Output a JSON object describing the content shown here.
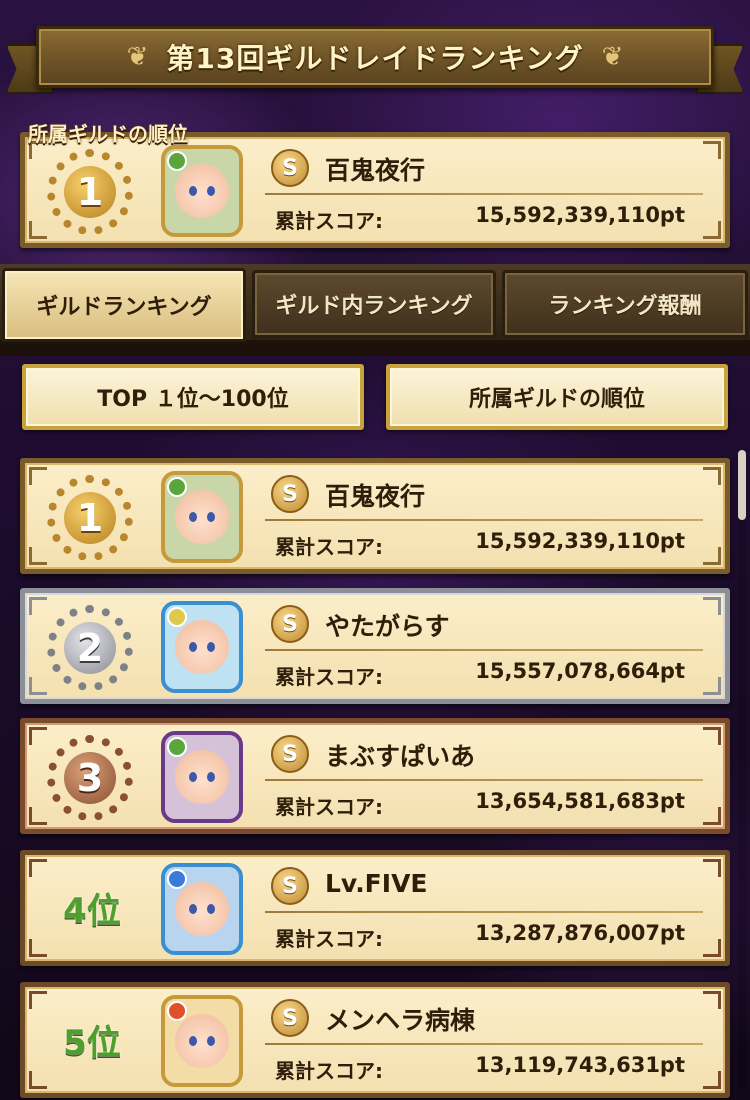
{
  "title": "第13回ギルドレイドランキング",
  "my_guild": {
    "section_label": "所属ギルドの順位",
    "rank": "1",
    "medal": "gold",
    "avatar_icon": "girl-green-bow-avatar",
    "element_color": "#5aa63c",
    "frame_color": "#c59a3a",
    "name": "百鬼夜行",
    "score_label": "累計スコア:",
    "score": "15,592,339,110pt"
  },
  "tabs": [
    {
      "label": "ギルドランキング",
      "active": true
    },
    {
      "label": "ギルド内ランキング",
      "active": false
    },
    {
      "label": "ランキング報酬",
      "active": false
    }
  ],
  "filters": {
    "top_label": "TOP １位〜100位",
    "mine_label": "所属ギルドの順位"
  },
  "ranking": [
    {
      "rank": "1",
      "medal": "gold",
      "name": "百鬼夜行",
      "score_label": "累計スコア:",
      "score": "15,592,339,110pt",
      "avatar_icon": "girl-green-bow-avatar",
      "element_color": "#5aa63c",
      "frame_color": "#c59a3a",
      "avatar_bg": "#c8d6a8"
    },
    {
      "rank": "2",
      "medal": "silver",
      "name": "やたがらす",
      "score_label": "累計スコア:",
      "score": "15,557,078,664pt",
      "avatar_icon": "white-creature-avatar",
      "element_color": "#e0c84a",
      "frame_color": "#3a8fd2",
      "avatar_bg": "#bfe2f2"
    },
    {
      "rank": "3",
      "medal": "bronze",
      "name": "まぶすぱいあ",
      "score_label": "累計スコア:",
      "score": "13,654,581,683pt",
      "avatar_icon": "vampire-girl-avatar",
      "element_color": "#5aa63c",
      "frame_color": "#6a3a8a",
      "avatar_bg": "#d6c2d8"
    },
    {
      "rank": "4位",
      "medal": "none",
      "name": "Lv.FIVE",
      "score_label": "累計スコア:",
      "score": "13,287,876,007pt",
      "avatar_icon": "blue-hair-girl-avatar",
      "element_color": "#3a7ad8",
      "frame_color": "#3a8fd2",
      "avatar_bg": "#b8d4ef"
    },
    {
      "rank": "5位",
      "medal": "none",
      "name": "メンヘラ病棟",
      "score_label": "累計スコア:",
      "score": "13,119,743,631pt",
      "avatar_icon": "blonde-maid-avatar",
      "element_color": "#e0502a",
      "frame_color": "#c59a3a",
      "avatar_bg": "#f4dca6"
    }
  ],
  "emblem_glyph": "S"
}
